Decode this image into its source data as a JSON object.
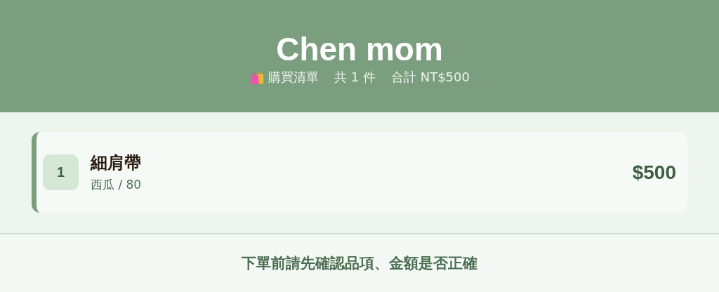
{
  "header": {
    "title": "Chen mom",
    "list_label": "購買清單",
    "count": "共 1 件",
    "total": "合計 NT$500"
  },
  "items": [
    {
      "index": "1",
      "name": "細肩帶",
      "detail": "西瓜 / 80",
      "price": "$500"
    }
  ],
  "footer_note": "下單前請先確認品項、金額是否正確"
}
